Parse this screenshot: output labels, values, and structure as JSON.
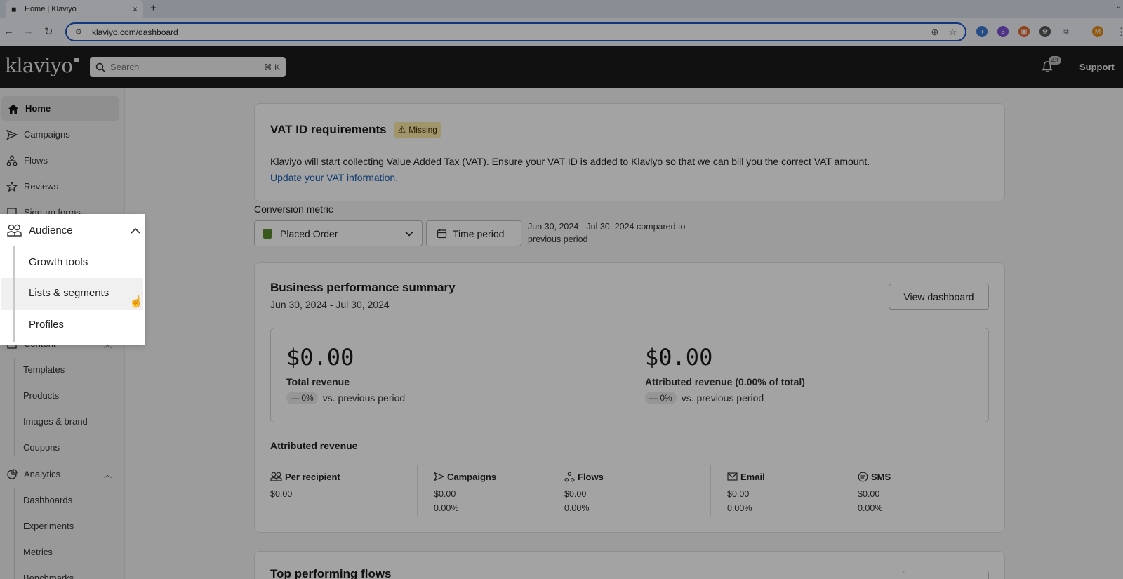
{
  "browser": {
    "tab_title": "Home | Klaviyo",
    "new_tab": "+",
    "tab_close": "×",
    "url": "klaviyo.com/dashboard",
    "profile_initial": "M",
    "ext_badge": "3"
  },
  "header": {
    "logo": "klaviyo",
    "search_placeholder": "Search",
    "search_shortcut": "⌘ K",
    "notification_count": "43",
    "support": "Support"
  },
  "sidebar": {
    "home": "Home",
    "campaigns": "Campaigns",
    "flows": "Flows",
    "reviews": "Reviews",
    "signup_forms": "Sign-up forms",
    "content": "Content",
    "content_items": [
      "Templates",
      "Products",
      "Images & brand",
      "Coupons"
    ],
    "analytics": "Analytics",
    "analytics_items": [
      "Dashboards",
      "Experiments",
      "Metrics",
      "Benchmarks"
    ]
  },
  "popover": {
    "title": "Audience",
    "items": [
      "Growth tools",
      "Lists & segments",
      "Profiles"
    ]
  },
  "vat": {
    "title": "VAT ID requirements",
    "badge": "Missing",
    "body": "Klaviyo will start collecting Value Added Tax (VAT). Ensure your VAT ID is added to Klaviyo so that we can bill you the correct VAT amount.",
    "link": "Update your VAT information."
  },
  "filters": {
    "conversion_label": "Conversion metric",
    "metric": "Placed Order",
    "time_period": "Time period",
    "range_line1": "Jun 30, 2024 - Jul 30, 2024 compared to",
    "range_line2": "previous period"
  },
  "summary": {
    "title": "Business performance summary",
    "subtitle": "Jun 30, 2024 - Jul 30, 2024",
    "view_dashboard": "View dashboard",
    "total_value": "$0.00",
    "total_label": "Total revenue",
    "total_change": "— 0%",
    "attributed_value": "$0.00",
    "attributed_label": "Attributed revenue (0.00% of total)",
    "attributed_change": "— 0%",
    "vs_label": "vs. previous period"
  },
  "attributed": {
    "title": "Attributed revenue",
    "metrics": [
      {
        "label": "Per recipient",
        "value": "$0.00",
        "pct": ""
      },
      {
        "label": "Campaigns",
        "value": "$0.00",
        "pct": "0.00%"
      },
      {
        "label": "Flows",
        "value": "$0.00",
        "pct": "0.00%"
      },
      {
        "label": "Email",
        "value": "$0.00",
        "pct": "0.00%"
      },
      {
        "label": "SMS",
        "value": "$0.00",
        "pct": "0.00%"
      }
    ]
  },
  "top_flows": {
    "title": "Top performing flows"
  },
  "colors": {
    "header_bg": "#1c1c1c",
    "link": "#1d5fb3",
    "badge_bg": "#fce9a8",
    "omnibox_border": "#1a56c8"
  },
  "icons": {
    "home": "home-icon",
    "campaigns": "send-icon",
    "flows": "flows-icon",
    "reviews": "star-icon",
    "audience": "users-icon",
    "analytics": "pie-icon",
    "search": "search-icon",
    "bell": "bell-icon",
    "calendar": "calendar-icon",
    "warning": "warning-icon"
  }
}
